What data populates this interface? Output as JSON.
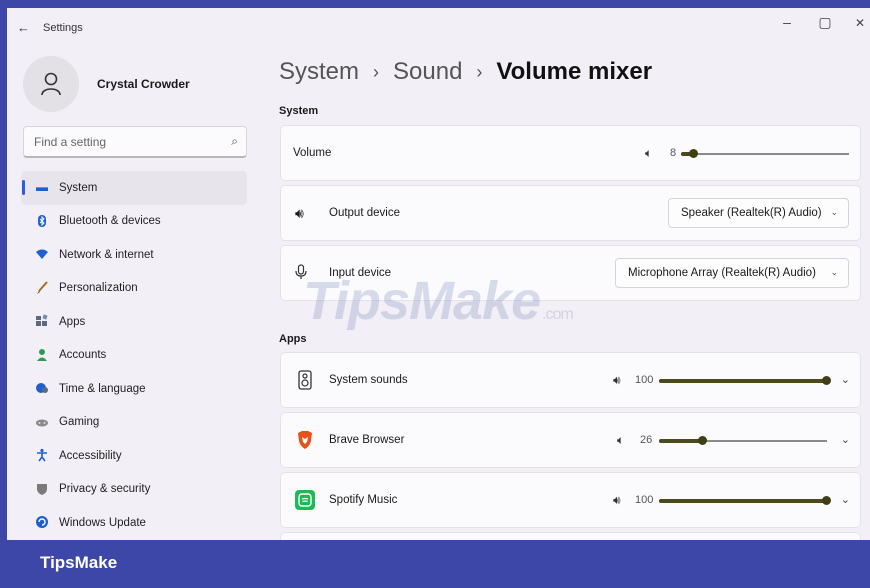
{
  "window": {
    "title": "Settings",
    "back": "←",
    "minimize": "–",
    "maximize": "▢",
    "close": "✕"
  },
  "profile": {
    "name": "Crystal Crowder"
  },
  "search": {
    "placeholder": "Find a setting"
  },
  "sidebar": {
    "items": [
      {
        "label": "System",
        "icon": "display-icon",
        "glyph": "▬",
        "color": "#1f5fd1"
      },
      {
        "label": "Bluetooth & devices",
        "icon": "bluetooth-icon",
        "glyph": "ʙ",
        "color": "#1f5fd1"
      },
      {
        "label": "Network & internet",
        "icon": "wifi-icon",
        "glyph": "▾",
        "color": "#1f5fd1"
      },
      {
        "label": "Personalization",
        "icon": "brush-icon",
        "glyph": "╱",
        "color": "#b06a1c"
      },
      {
        "label": "Apps",
        "icon": "apps-icon",
        "glyph": "▦",
        "color": "#5a6a80"
      },
      {
        "label": "Accounts",
        "icon": "account-icon",
        "glyph": "●",
        "color": "#2e9a5a"
      },
      {
        "label": "Time & language",
        "icon": "globe-clock-icon",
        "glyph": "◔",
        "color": "#1f5fd1"
      },
      {
        "label": "Gaming",
        "icon": "gamepad-icon",
        "glyph": "◉",
        "color": "#8a8a8a"
      },
      {
        "label": "Accessibility",
        "icon": "accessibility-icon",
        "glyph": "✻",
        "color": "#1f5fd1"
      },
      {
        "label": "Privacy & security",
        "icon": "shield-icon",
        "glyph": "⛉",
        "color": "#7a7a7a"
      },
      {
        "label": "Windows Update",
        "icon": "update-icon",
        "glyph": "⟳",
        "color": "#1f5fd1"
      }
    ]
  },
  "breadcrumb": {
    "part1": "System",
    "sep": "›",
    "part2": "Sound",
    "current": "Volume mixer"
  },
  "system_section": {
    "title": "System",
    "volume": {
      "label": "Volume",
      "value": "8",
      "level": 8
    },
    "output": {
      "label": "Output device",
      "selected": "Speaker (Realtek(R) Audio)"
    },
    "input": {
      "label": "Input device",
      "selected": "Microphone Array (Realtek(R) Audio)"
    }
  },
  "apps_section": {
    "title": "Apps",
    "apps": [
      {
        "name": "System sounds",
        "value": "100",
        "level": 100,
        "icon": "speaker-box-icon"
      },
      {
        "name": "Brave Browser",
        "value": "26",
        "level": 26,
        "icon": "brave-lion-icon"
      },
      {
        "name": "Spotify Music",
        "value": "100",
        "level": 100,
        "icon": "spotify-icon"
      }
    ]
  },
  "watermark": {
    "main": "TipsMake",
    "suffix": ".com"
  },
  "footer": {
    "brand": "TipsMake"
  },
  "colors": {
    "accent": "#2b5dd9",
    "slider": "#4b4a1a",
    "footer_bg": "#3c47a8"
  }
}
